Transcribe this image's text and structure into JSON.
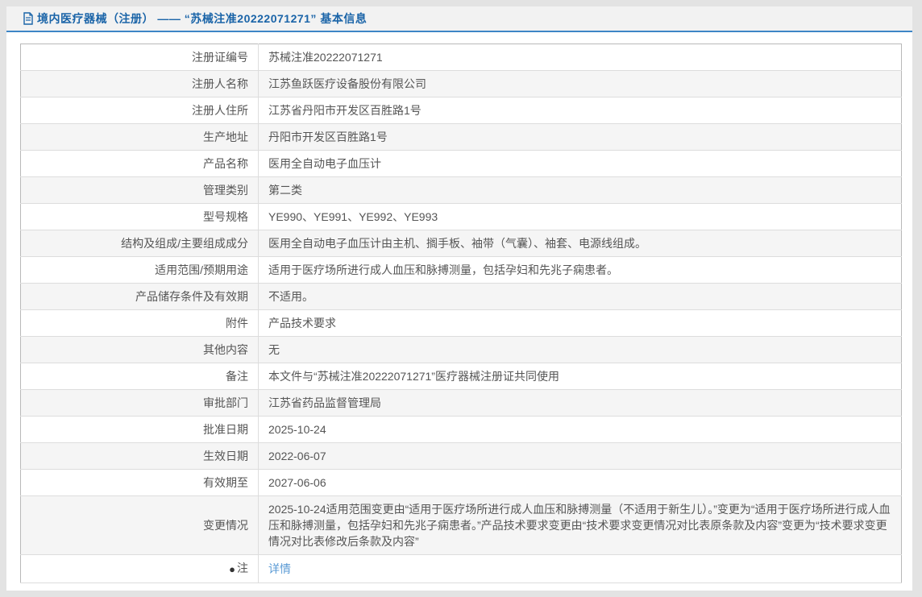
{
  "header": {
    "title": "境内医疗器械（注册） —— “苏械注准20222071271” 基本信息",
    "icon": "document-icon"
  },
  "colors": {
    "title_blue": "#1a64a8",
    "title_underline": "#3d85c6",
    "link_blue": "#5b9bd5",
    "alt_row_bg": "#f5f5f5",
    "page_bg": "#e3e3e3",
    "text": "#555555"
  },
  "table": {
    "rows": [
      {
        "label": "注册证编号",
        "value": "苏械注准20222071271"
      },
      {
        "label": "注册人名称",
        "value": "江苏鱼跃医疗设备股份有限公司"
      },
      {
        "label": "注册人住所",
        "value": "江苏省丹阳市开发区百胜路1号"
      },
      {
        "label": "生产地址",
        "value": "丹阳市开发区百胜路1号"
      },
      {
        "label": "产品名称",
        "value": "医用全自动电子血压计"
      },
      {
        "label": "管理类别",
        "value": "第二类"
      },
      {
        "label": "型号规格",
        "value": "YE990、YE991、YE992、YE993"
      },
      {
        "label": "结构及组成/主要组成成分",
        "value": "医用全自动电子血压计由主机、搁手板、袖带（气囊）、袖套、电源线组成。"
      },
      {
        "label": "适用范围/预期用途",
        "value": "适用于医疗场所进行成人血压和脉搏测量，包括孕妇和先兆子痫患者。"
      },
      {
        "label": "产品储存条件及有效期",
        "value": "不适用。"
      },
      {
        "label": "附件",
        "value": "产品技术要求"
      },
      {
        "label": "其他内容",
        "value": "无"
      },
      {
        "label": "备注",
        "value": "本文件与“苏械注准20222071271”医疗器械注册证共同使用"
      },
      {
        "label": "审批部门",
        "value": "江苏省药品监督管理局"
      },
      {
        "label": "批准日期",
        "value": "2025-10-24"
      },
      {
        "label": "生效日期",
        "value": "2022-06-07"
      },
      {
        "label": "有效期至",
        "value": "2027-06-06"
      },
      {
        "label": "变更情况",
        "value": "2025-10-24适用范围变更由“适用于医疗场所进行成人血压和脉搏测量（不适用于新生儿）。”变更为“适用于医疗场所进行成人血压和脉搏测量，包括孕妇和先兆子痫患者。”产品技术要求变更由“技术要求变更情况对比表原条款及内容”变更为“技术要求变更情况对比表修改后条款及内容”"
      },
      {
        "label": "注",
        "icon": "bulb",
        "value": "详情",
        "value_is_link": true
      }
    ]
  }
}
